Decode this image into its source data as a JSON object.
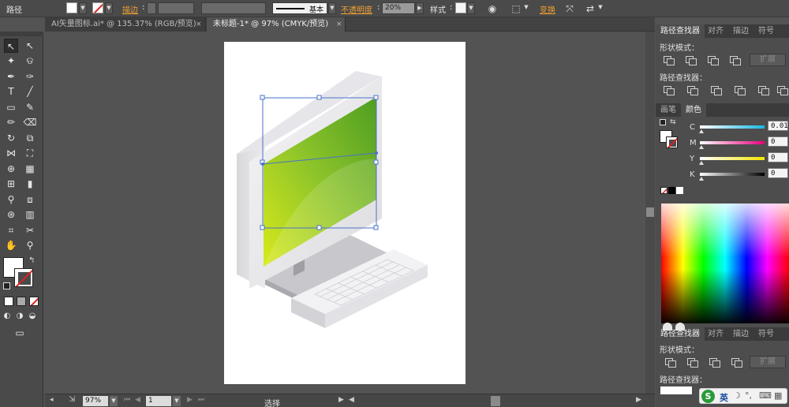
{
  "control_bar": {
    "object_type": "路径",
    "stroke_label": "描边",
    "stroke_style": "基本",
    "opacity_label": "不透明度",
    "opacity_value": "20%",
    "style_label": "样式",
    "transform_label": "变换"
  },
  "tabs": [
    {
      "label": "AI矢量图标.ai* @ 135.37% (RGB/预览)",
      "close": "×"
    },
    {
      "label": "未标题-1* @ 97% (CMYK/预览)",
      "close": "×"
    }
  ],
  "pathfinder": {
    "tabs": [
      "路径查找器",
      "对齐",
      "描边",
      "符号"
    ],
    "shape_modes_label": "形状模式：",
    "pathfinders_label": "路径查找器：",
    "expand_label": "扩展"
  },
  "color": {
    "tabs": [
      "画笔",
      "颜色"
    ],
    "channels": [
      {
        "name": "C",
        "value": "0.01",
        "color": "#19b7e6"
      },
      {
        "name": "M",
        "value": "0",
        "color": "#e6007e"
      },
      {
        "name": "Y",
        "value": "0",
        "color": "#f2e600"
      },
      {
        "name": "K",
        "value": "0",
        "color": "#000000"
      }
    ]
  },
  "pathfinder2": {
    "tabs": [
      "路径查找器",
      "对齐",
      "描边",
      "符号"
    ],
    "shape_modes_label": "形状模式：",
    "pathfinders_label": "路径查找器：",
    "expand_label": "扩展"
  },
  "status": {
    "zoom": "97%",
    "artboard_num": "1",
    "tool": "选择"
  },
  "ime": {
    "lang": "英"
  },
  "colors": {
    "screen_light": "#cce61a",
    "screen_dark": "#3a9a1a",
    "selection": "#4a72c8"
  }
}
